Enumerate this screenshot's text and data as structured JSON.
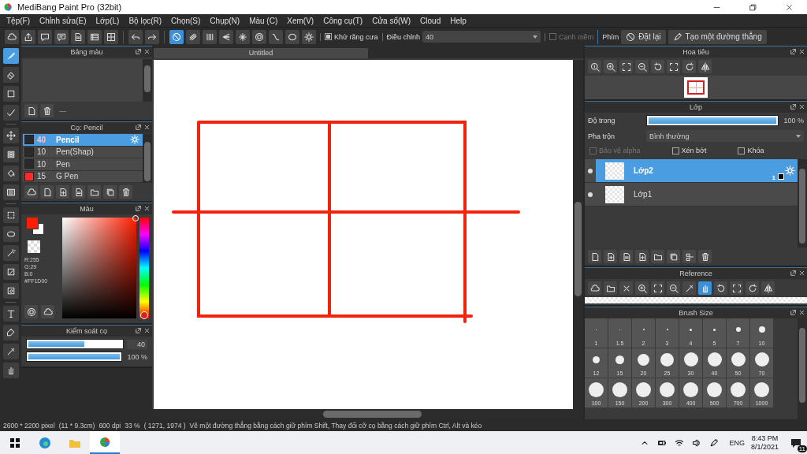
{
  "window": {
    "title": "MediBang Paint Pro (32bit)"
  },
  "menu": [
    "Tệp(F)",
    "Chỉnh sửa(E)",
    "Lớp(L)",
    "Bộ lọc(R)",
    "Chọn(S)",
    "Chụp(N)",
    "Màu (C)",
    "Xem(V)",
    "Công cụ(T)",
    "Cửa sổ(W)",
    "Cloud",
    "Help"
  ],
  "ruler_modes": [
    {
      "selected": true
    },
    {
      "selected": false
    },
    {
      "selected": false
    },
    {
      "selected": false
    },
    {
      "selected": false
    },
    {
      "selected": false
    },
    {
      "selected": false
    },
    {
      "selected": false
    }
  ],
  "toolbar": {
    "anti_alias": {
      "label": "Khử răng cưa",
      "checked": true
    },
    "correction": {
      "label": "Điều chỉnh",
      "value": "40"
    },
    "soft_edge": {
      "label": "Cạnh mềm",
      "checked": false,
      "disabled": true
    },
    "snap_label": "Phím",
    "buttons": [
      "Đặt lại",
      "Tạo một đường thẳng"
    ]
  },
  "tools": [
    {
      "selected": true
    },
    {
      "selected": false
    },
    {
      "selected": false
    },
    {
      "selected": false
    },
    {
      "selected": false
    },
    {
      "selected": false
    },
    {
      "selected": false
    },
    {
      "selected": false
    },
    {
      "selected": false
    },
    {
      "selected": false
    },
    {
      "selected": false
    },
    {
      "selected": false
    },
    {
      "selected": false
    },
    {
      "selected": false
    },
    {
      "selected": false
    },
    {
      "selected": false
    },
    {
      "selected": false
    }
  ],
  "palette": {
    "title": "Bảng màu",
    "name": "---"
  },
  "brushes": {
    "title": "Cọ: Pencil",
    "items": [
      {
        "size": "40",
        "name": "Pencil",
        "color": "#2a2a2a",
        "selected": true
      },
      {
        "size": "10",
        "name": "Pen(Shap)",
        "color": "#2a2a2a",
        "selected": false
      },
      {
        "size": "10",
        "name": "Pen",
        "color": "#2a2a2a",
        "selected": false
      },
      {
        "size": "15",
        "name": "G Pen",
        "color": "#ff2a2a",
        "selected": false
      }
    ]
  },
  "color": {
    "title": "Màu",
    "color": "#ff1d00",
    "hue": {
      "level": 0
    },
    "readouts": [
      "R:255",
      "G:29",
      "B:0",
      "#FF1D00"
    ]
  },
  "brush_control": {
    "title": "Kiểm soát cọ",
    "sliders": [
      {
        "level": 0.6,
        "reading": "40"
      },
      {
        "level": 1,
        "reading": "100 %"
      }
    ]
  },
  "canvas": {
    "tab": "Untitled"
  },
  "navigator": {
    "title": "Hoa tiêu"
  },
  "layers": {
    "title": "Lớp",
    "opacity_label": "Độ trong",
    "opacity": {
      "level": 1,
      "reading": "100 %"
    },
    "blend_label": "Pha trộn",
    "blend": "Bình thường",
    "options": [
      {
        "label": "Bảo vệ alpha",
        "checked": false,
        "disabled": true
      },
      {
        "label": "Xén bớt",
        "checked": false,
        "disabled": false
      },
      {
        "label": "Khóa",
        "checked": false,
        "disabled": false
      }
    ],
    "items": [
      {
        "name": "Lớp2",
        "selected": true,
        "visible": true,
        "badge": "1"
      },
      {
        "name": "Lớp1",
        "selected": false,
        "visible": true
      }
    ]
  },
  "reference": {
    "title": "Reference",
    "tools": [
      {
        "selected": false
      },
      {
        "selected": false
      },
      {
        "selected": false
      },
      {
        "selected": false
      },
      {
        "selected": false
      },
      {
        "selected": false
      },
      {
        "selected": false
      },
      {
        "selected": true
      },
      {
        "selected": false
      },
      {
        "selected": false
      },
      {
        "selected": false
      },
      {
        "selected": false
      }
    ]
  },
  "brush_size": {
    "title": "Brush Size",
    "sizes": [
      "1",
      "1.5",
      "2",
      "3",
      "4",
      "5",
      "7",
      "10",
      "12",
      "15",
      "20",
      "25",
      "30",
      "40",
      "50",
      "70",
      "100",
      "150",
      "200",
      "300",
      "400",
      "500",
      "700",
      "1000"
    ]
  },
  "status_bar": [
    "2600 * 2200 pixel",
    "(11 * 9.3cm)",
    "600 dpi",
    "33 %",
    "( 1271, 1974 )",
    "Vẽ một đường thẳng bằng cách giữ phím Shift, Thay đổi cỡ cọ bằng cách giữ phím Ctrl, Alt và kéo"
  ],
  "taskbar": {
    "apps": [
      {
        "selected": false
      },
      {
        "selected": false
      },
      {
        "selected": false
      },
      {
        "selected": true
      }
    ],
    "language": "ENG",
    "time": "8:43 PM",
    "date": "8/1/2021",
    "notifications": "11"
  }
}
